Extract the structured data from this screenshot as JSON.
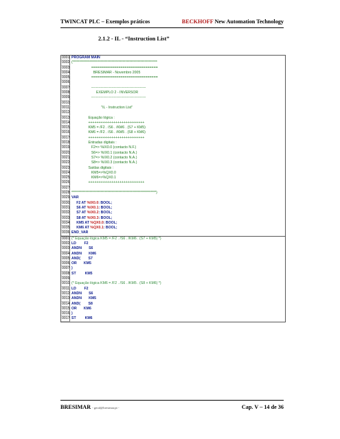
{
  "header": {
    "left": "TWINCAT PLC – Exemplos práticos",
    "right_brand": "BECKHOFF",
    "right_rest": " New Automation Technology"
  },
  "section_title": "2.1.2 - IL - “Instruction List”",
  "code_blocks": [
    {
      "lines": [
        {
          "n": "0001",
          "text": "PROGRAM MAIN",
          "kind": "kw"
        },
        {
          "n": "0002",
          "text": "(*************************************************************",
          "kind": "cm"
        },
        {
          "n": "0003",
          "text": "                    ================================",
          "kind": "cm"
        },
        {
          "n": "0004",
          "text": "                      BRESIMAR - Novembro 2005",
          "kind": "cm"
        },
        {
          "n": "0005",
          "text": "                    ================================",
          "kind": "cm"
        },
        {
          "n": "0006",
          "text": "",
          "kind": "cm"
        },
        {
          "n": "0007",
          "text": "                    ----------------------------------------------",
          "kind": "cm"
        },
        {
          "n": "0008",
          "text": "                         EXEMPLO 2 - INVERSOR",
          "kind": "cm"
        },
        {
          "n": "0009",
          "text": "                    ----------------------------------------------",
          "kind": "cm"
        },
        {
          "n": "0010",
          "text": "",
          "kind": "cm"
        },
        {
          "n": "0011",
          "text": "                              \"IL - Instruction List\"",
          "kind": "cm"
        },
        {
          "n": "0012",
          "text": "",
          "kind": "cm"
        },
        {
          "n": "0013",
          "text": "                 Equação lógica :",
          "kind": "cm"
        },
        {
          "n": "0014",
          "text": "                 +++++++++++++++++++++++++++",
          "kind": "cm"
        },
        {
          "n": "0015",
          "text": "                 KM5 = /F2 . /S6 . /KM6 . (S7 + KM5)",
          "kind": "cm"
        },
        {
          "n": "0016",
          "text": "                 KM6 = /F2 . /S6 . /KM5 . (S8 + KM6)",
          "kind": "cm"
        },
        {
          "n": "0017",
          "text": "                 +++++++++++++++++++++++++++",
          "kind": "cm"
        },
        {
          "n": "0018",
          "text": "                 Entradas digitais :",
          "kind": "cm"
        },
        {
          "n": "0019",
          "text": "                    F2=> %IX0.0 (contacto N.F.)",
          "kind": "cm"
        },
        {
          "n": "0020",
          "text": "                    S6=> %IX0.1 (contacto N.A.)",
          "kind": "cm"
        },
        {
          "n": "0021",
          "text": "                    S7=> %IX0.2 (contacto N.A.)",
          "kind": "cm"
        },
        {
          "n": "0022",
          "text": "                    S8=> %IX0.3 (contacto N.A.)",
          "kind": "cm"
        },
        {
          "n": "0023",
          "text": "                 Saídas digitais :",
          "kind": "cm"
        },
        {
          "n": "0024",
          "text": "                    KM5=>%QX0.0",
          "kind": "cm"
        },
        {
          "n": "0025",
          "text": "                    KM6=>%QX0.1",
          "kind": "cm"
        },
        {
          "n": "0026",
          "text": "                 +++++++++++++++++++++++++++",
          "kind": "cm"
        },
        {
          "n": "0027",
          "text": "",
          "kind": "cm"
        },
        {
          "n": "0028",
          "text": "*************************************************************)",
          "kind": "cm"
        },
        {
          "n": "0029",
          "text": "VAR",
          "kind": "kw"
        },
        {
          "n": "0030",
          "text": "     F2 AT |%IX0.0|: BOOL;",
          "kind": "kw"
        },
        {
          "n": "0031",
          "text": "     S6 AT |%IX0.1|: BOOL;",
          "kind": "kw"
        },
        {
          "n": "0032",
          "text": "     S7 AT |%IX0.2|: BOOL;",
          "kind": "kw"
        },
        {
          "n": "0033",
          "text": "     S8 AT |%IX0.3|: BOOL;",
          "kind": "kw"
        },
        {
          "n": "0034",
          "text": "     KM5 AT |%QX0.0|: BOOL;",
          "kind": "kw"
        },
        {
          "n": "0035",
          "text": "     KM6 AT |%QX0.1|: BOOL;",
          "kind": "kw"
        },
        {
          "n": "0036",
          "text": "END_VAR",
          "kind": "kw"
        }
      ]
    },
    {
      "lines": [
        {
          "n": "0001",
          "text": "(* Equação lógica KM5 = /F2 . /S6 . /KM6 . (S7 + KM5) *)",
          "kind": "tx"
        },
        {
          "n": "0002",
          "text": "LD        F2",
          "kind": "kw"
        },
        {
          "n": "0003",
          "text": "ANDN       S6",
          "kind": "kw"
        },
        {
          "n": "0004",
          "text": "ANDN       KM6",
          "kind": "kw"
        },
        {
          "n": "0005",
          "text": "AND(        S7",
          "kind": "kw"
        },
        {
          "n": "0006",
          "text": "OR       KM5",
          "kind": "kw"
        },
        {
          "n": "0007",
          "text": ")",
          "kind": "kw"
        },
        {
          "n": "0008",
          "text": "ST         KM5",
          "kind": "kw"
        },
        {
          "n": "0009",
          "text": "",
          "kind": "kw"
        },
        {
          "n": "0010",
          "text": "(* Equação lógica KM6 = /F2 . /S6 . /KM5 . (S8 + KM6) *)",
          "kind": "tx"
        },
        {
          "n": "0011",
          "text": "LD        F2",
          "kind": "kw"
        },
        {
          "n": "0012",
          "text": "ANDN       S6",
          "kind": "kw"
        },
        {
          "n": "0013",
          "text": "ANDN       KM5",
          "kind": "kw"
        },
        {
          "n": "0014",
          "text": "AND(        S8",
          "kind": "kw"
        },
        {
          "n": "0015",
          "text": "OR       KM6",
          "kind": "kw"
        },
        {
          "n": "0016",
          "text": ")",
          "kind": "kw"
        },
        {
          "n": "0017",
          "text": "ST         KM6",
          "kind": "kw"
        },
        {
          "n": "0018",
          "text": "",
          "kind": "kw"
        }
      ]
    }
  ],
  "footer": {
    "left": "BRESIMAR",
    "email": "- geral@bresimar.pt -",
    "right": "Cap. V – 14 de 36"
  }
}
